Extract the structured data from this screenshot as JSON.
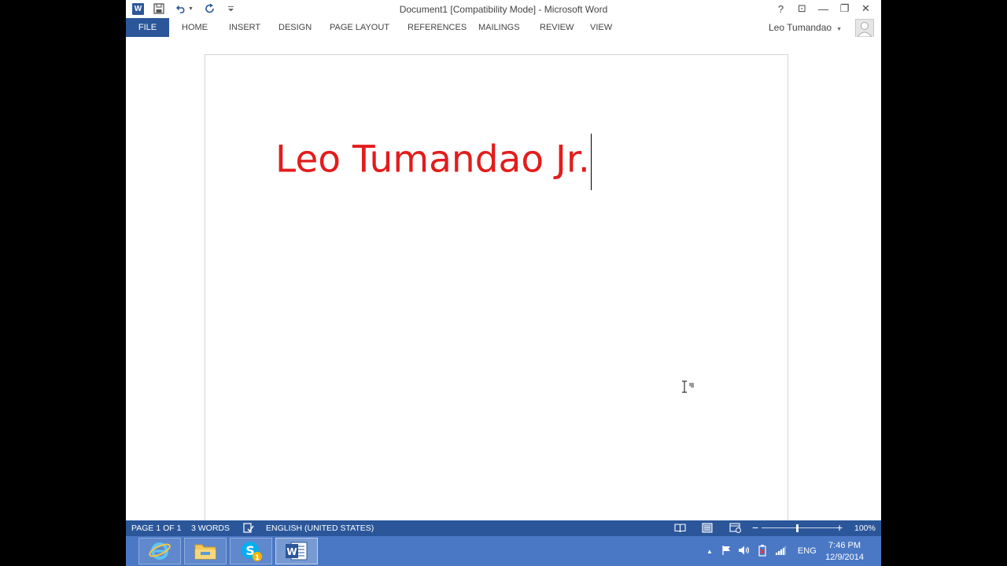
{
  "window": {
    "title": "Document1 [Compatibility Mode] - Microsoft Word",
    "controls": {
      "help": "?",
      "ribbon_display": "⊡",
      "minimize": "—",
      "restore": "❐",
      "close": "✕"
    }
  },
  "quick_access": {
    "app_icon_letter": "W",
    "icons": [
      "word-logo-icon",
      "save-icon",
      "undo-icon",
      "redo-icon",
      "customize-qat-icon"
    ]
  },
  "ribbon": {
    "tabs": [
      {
        "label": "FILE"
      },
      {
        "label": "HOME"
      },
      {
        "label": "INSERT"
      },
      {
        "label": "DESIGN"
      },
      {
        "label": "PAGE LAYOUT"
      },
      {
        "label": "REFERENCES"
      },
      {
        "label": "MAILINGS"
      },
      {
        "label": "REVIEW"
      },
      {
        "label": "VIEW"
      }
    ],
    "user_name": "Leo Tumandao"
  },
  "document": {
    "text": "Leo Tumandao Jr."
  },
  "colors": {
    "accent": "#2b579a",
    "document_text": "#e31c1c",
    "taskbar": "#4a78c5"
  },
  "status_bar": {
    "page": "PAGE 1 OF 1",
    "words": "3 WORDS",
    "language": "ENGLISH (UNITED STATES)",
    "zoom": "100%",
    "zoom_percent": 100
  },
  "taskbar": {
    "apps": [
      "internet-explorer-icon",
      "file-explorer-icon",
      "skype-icon",
      "word-icon"
    ],
    "skype_badge": "1",
    "language": "ENG",
    "time": "7:46 PM",
    "date": "12/9/2014"
  }
}
